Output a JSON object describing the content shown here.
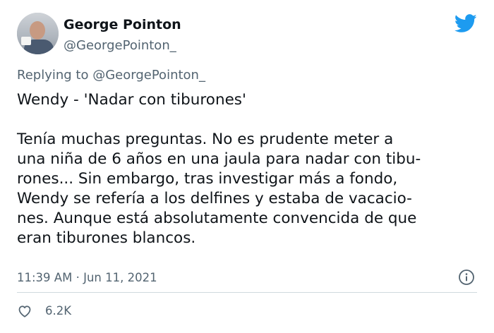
{
  "author": {
    "name": "George Pointon",
    "handle": "@GeorgePointon_",
    "avatar_icon": "profile-photo"
  },
  "platform_icon": "twitter-bird-icon",
  "replying": {
    "prefix": "Replying to",
    "mention": "@GeorgePointon_"
  },
  "tweet": {
    "line1": "Wendy - 'Nadar con tiburones'",
    "lines": [
      "Tenía muchas preguntas. No es prudente meter a",
      "una niña de 6 años en una jaula para nadar con tibu-",
      "rones... Sin embargo, tras investigar más a fondo,",
      "Wendy se refería a los delfines y estaba de vacacio-",
      "nes. Aunque está absolutamente convencida de que",
      "eran tiburones blancos."
    ]
  },
  "meta": {
    "time": "11:39 AM",
    "separator": "·",
    "date": "Jun 11, 2021"
  },
  "engagement": {
    "likes": "6.2K"
  },
  "colors": {
    "text": "#0f1419",
    "secondary": "#536471",
    "twitter_blue": "#1d9bf0",
    "divider": "#cfd9de"
  }
}
